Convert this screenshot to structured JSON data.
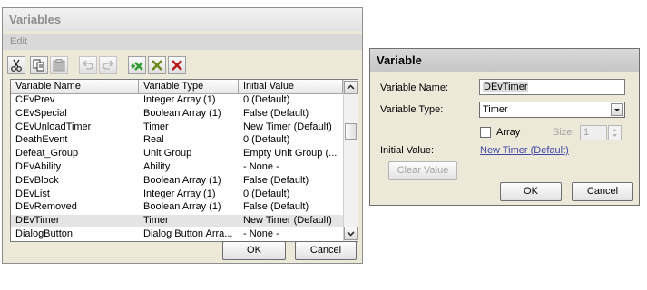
{
  "variables_window": {
    "title": "Variables",
    "menu": "Edit",
    "toolbar": [
      {
        "icon": "cut-icon",
        "enabled": true
      },
      {
        "icon": "copy-icon",
        "enabled": true
      },
      {
        "icon": "paste-icon",
        "enabled": false
      },
      {
        "icon": "undo-icon",
        "enabled": false
      },
      {
        "icon": "redo-icon",
        "enabled": false
      },
      {
        "icon": "add-variable-icon",
        "enabled": true
      },
      {
        "icon": "remove-icon",
        "enabled": true
      },
      {
        "icon": "delete-icon",
        "enabled": true
      }
    ],
    "columns": [
      "Variable Name",
      "Variable Type",
      "Initial Value"
    ],
    "rows": [
      {
        "name": "CEvPrev",
        "type": "Integer Array (1)",
        "value": "0 (Default)"
      },
      {
        "name": "CEvSpecial",
        "type": "Boolean Array (1)",
        "value": "False (Default)"
      },
      {
        "name": "CEvUnloadTimer",
        "type": "Timer",
        "value": "New Timer (Default)"
      },
      {
        "name": "DeathEvent",
        "type": "Real",
        "value": "0 (Default)"
      },
      {
        "name": "Defeat_Group",
        "type": "Unit Group",
        "value": "Empty Unit Group (..."
      },
      {
        "name": "DEvAbility",
        "type": "Ability",
        "value": "- None -"
      },
      {
        "name": "DEvBlock",
        "type": "Boolean Array (1)",
        "value": "False (Default)"
      },
      {
        "name": "DEvList",
        "type": "Integer Array (1)",
        "value": "0 (Default)"
      },
      {
        "name": "DEvRemoved",
        "type": "Boolean Array (1)",
        "value": "False (Default)"
      },
      {
        "name": "DEvTimer",
        "type": "Timer",
        "value": "New Timer (Default)",
        "selected": true
      },
      {
        "name": "DialogButton",
        "type": "Dialog Button Arra...",
        "value": "- None -"
      }
    ],
    "ok_label": "OK",
    "cancel_label": "Cancel"
  },
  "variable_dialog": {
    "title": "Variable",
    "name_label": "Variable Name:",
    "name_value": "DEvTimer",
    "type_label": "Variable Type:",
    "type_value": "Timer",
    "array_label": "Array",
    "array_checked": false,
    "size_label": "Size:",
    "size_value": "1",
    "initial_label": "Initial Value:",
    "initial_value": "New Timer (Default)",
    "clear_label": "Clear Value",
    "ok_label": "OK",
    "cancel_label": "Cancel"
  },
  "colors": {
    "window_bg": "#ece9d8",
    "link": "#4147a5",
    "add_green": "#2e9a2e",
    "remove_olive": "#6a8a1a",
    "delete_red": "#b81818"
  }
}
